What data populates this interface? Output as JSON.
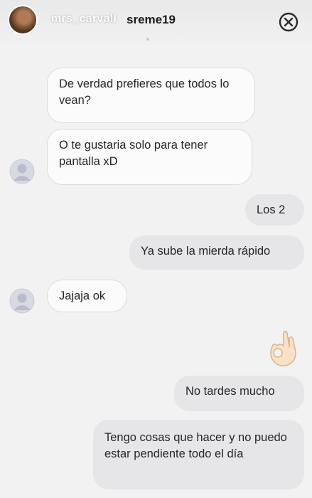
{
  "header": {
    "story_username": "mrs_carvall",
    "chat_title": "sreme19"
  },
  "messages": [
    {
      "side": "in",
      "text": "De verdad prefieres que todos lo vean?"
    },
    {
      "side": "in",
      "text": "O te gustaria solo para tener pantalla xD"
    },
    {
      "side": "out",
      "text": "Los 2"
    },
    {
      "side": "out",
      "text": "Ya sube la mierda rápido"
    },
    {
      "side": "in",
      "text": "Jajaja ok"
    },
    {
      "side": "out",
      "emoji": "ok-hand-emoji"
    },
    {
      "side": "out",
      "text": "No tardes mucho"
    },
    {
      "side": "out",
      "text": "Tengo cosas que hacer y no puedo estar pendiente todo el día"
    }
  ],
  "colors": {
    "background": "#f2f2f3",
    "incoming_bubble": "#fbfbfc",
    "outgoing_bubble": "#e6e6e8",
    "avatar_placeholder": "#c5c8d6"
  }
}
